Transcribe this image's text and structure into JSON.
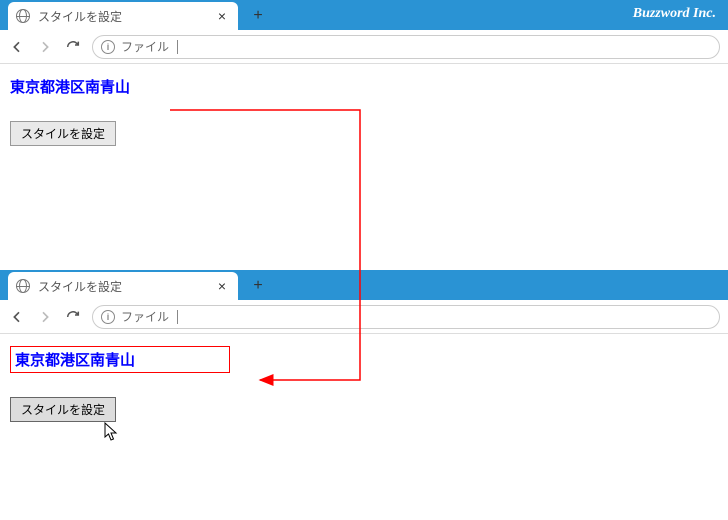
{
  "brand": "Buzzword Inc.",
  "window1": {
    "tab_title": "スタイルを設定",
    "close": "×",
    "newtab": "+",
    "addr_label": "ファイル",
    "info_char": "i",
    "content_text": "東京都港区南青山",
    "button_label": "スタイルを設定"
  },
  "window2": {
    "tab_title": "スタイルを設定",
    "close": "×",
    "newtab": "+",
    "addr_label": "ファイル",
    "info_char": "i",
    "content_text": "東京都港区南青山",
    "button_label": "スタイルを設定"
  }
}
